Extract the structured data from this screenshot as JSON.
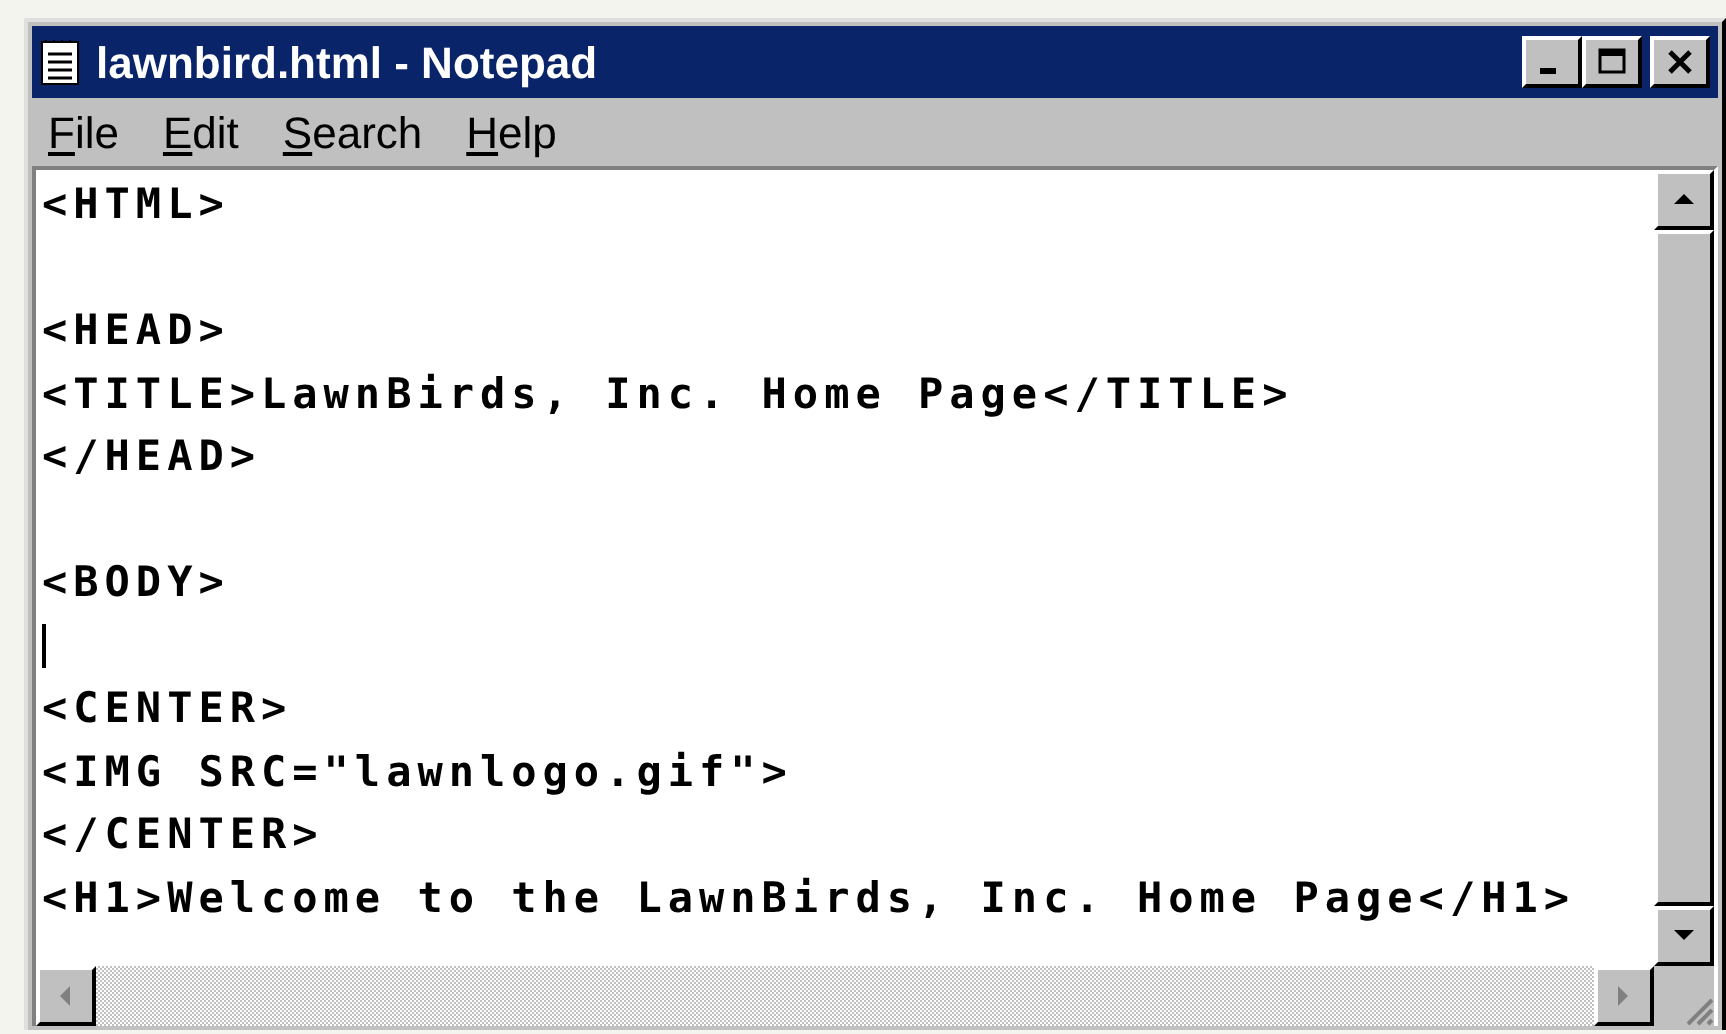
{
  "window": {
    "title": "lawnbird.html - Notepad"
  },
  "menu": [
    {
      "label": "File"
    },
    {
      "label": "Edit"
    },
    {
      "label": "Search"
    },
    {
      "label": "Help"
    }
  ],
  "lines": [
    {
      "kind": "text",
      "text": "<HTML>"
    },
    {
      "kind": "blank"
    },
    {
      "kind": "text",
      "text": "<HEAD>"
    },
    {
      "kind": "text",
      "text": "<TITLE>LawnBirds, Inc. Home Page</TITLE>"
    },
    {
      "kind": "text",
      "text": "</HEAD>"
    },
    {
      "kind": "blank"
    },
    {
      "kind": "text",
      "text": "<BODY>"
    },
    {
      "kind": "caret"
    },
    {
      "kind": "text",
      "text": "<CENTER>"
    },
    {
      "kind": "text",
      "text": "<IMG SRC=\"lawnlogo.gif\">"
    },
    {
      "kind": "text",
      "text": "</CENTER>"
    },
    {
      "kind": "text",
      "text": "<H1>Welcome to the LawnBirds, Inc. Home Page</H1>"
    }
  ]
}
